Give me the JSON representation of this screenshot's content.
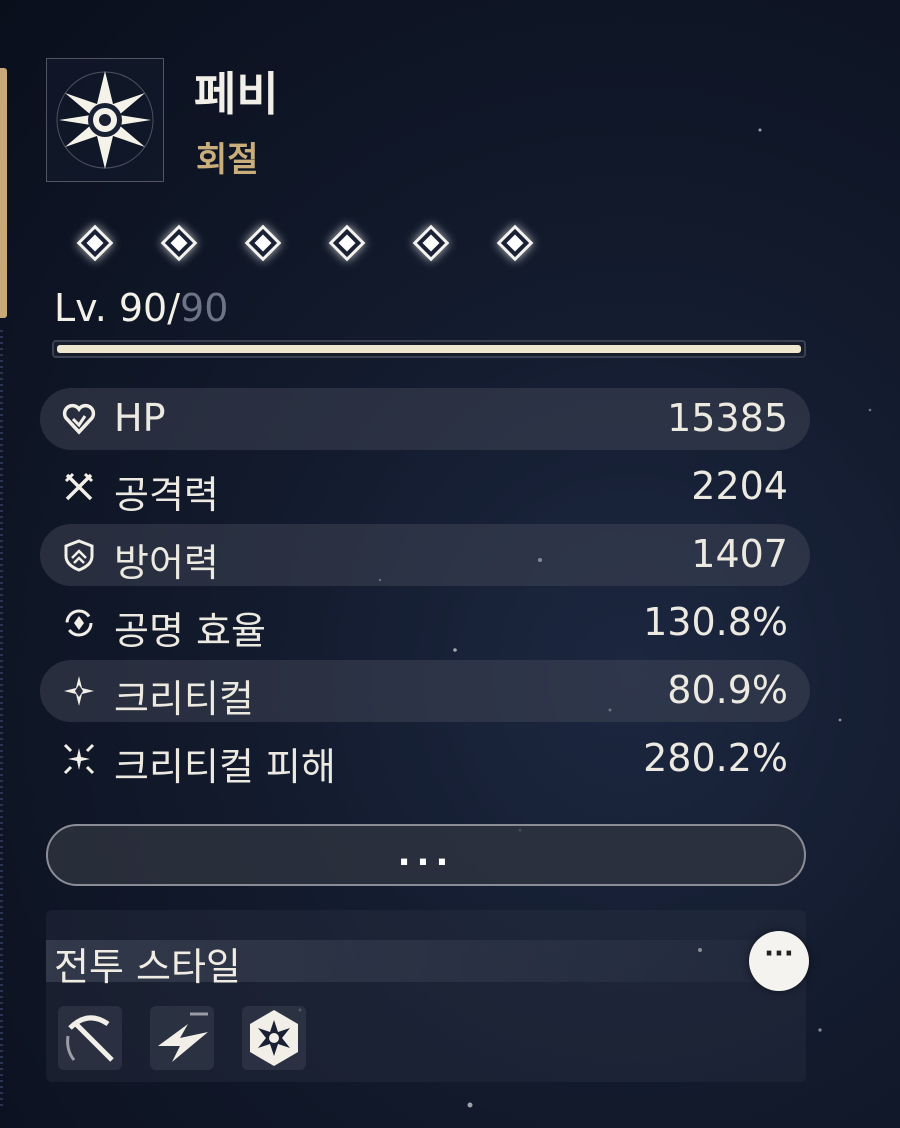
{
  "character": {
    "name": "페비",
    "element": "회절",
    "stars": 6,
    "level": "Lv. 90/",
    "level_max": "90",
    "level_progress": 1.0
  },
  "stats": [
    {
      "icon": "heart-icon",
      "label": "HP",
      "value": "15385"
    },
    {
      "icon": "crossed-swords-icon",
      "label": "공격력",
      "value": "2204"
    },
    {
      "icon": "shield-icon",
      "label": "방어력",
      "value": "1407"
    },
    {
      "icon": "energy-cycle-icon",
      "label": "공명 효율",
      "value": "130.8%"
    },
    {
      "icon": "crit-star-icon",
      "label": "크리티컬",
      "value": "80.9%"
    },
    {
      "icon": "crit-burst-icon",
      "label": "크리티컬 피해",
      "value": "280.2%"
    }
  ],
  "more_button": "...",
  "battle_style": {
    "title": "전투 스타일",
    "menu_icon": "kebab-menu-icon",
    "skills": [
      "scythe-skill-icon",
      "lightning-skill-icon",
      "gear-sun-skill-icon"
    ]
  },
  "colors": {
    "accent_gold": "#c9ad7a",
    "text": "#ece9e1",
    "row_shade": "#464b5c"
  }
}
